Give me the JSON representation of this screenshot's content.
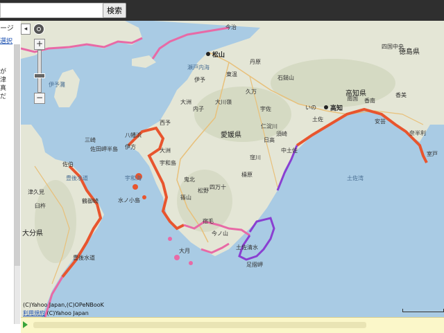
{
  "search": {
    "value": "",
    "button_label": "検索"
  },
  "sidebar": {
    "top_label": "ージ",
    "link_label": "選択",
    "snippets": [
      "が",
      "津",
      "真",
      "だ"
    ]
  },
  "controls": {
    "collapse_label": "◂",
    "zoom_in_label": "+",
    "zoom_out_label": "−"
  },
  "map": {
    "prefectures": [
      "愛媛県",
      "高知県",
      "徳島県",
      "大分県"
    ],
    "cities": [
      "松山",
      "高知",
      "宇和島",
      "大洲",
      "八幡浜",
      "西予",
      "宿毛",
      "土佐清水",
      "大月",
      "四万十",
      "須崎",
      "安芸",
      "今治",
      "佐伯",
      "臼杵",
      "津久見"
    ],
    "places": [
      "大川嶺",
      "石鎚山",
      "東温",
      "久万",
      "伊予",
      "内子",
      "仁淀川",
      "いの",
      "土佐",
      "南国",
      "香南",
      "香美",
      "奈半利",
      "室戸",
      "日高",
      "中土佐",
      "檮原",
      "鬼北",
      "松野",
      "四国中央",
      "丹原",
      "三崎",
      "伊方",
      "佐田岬半島",
      "宇佐",
      "窪川",
      "今ノ山",
      "篠山",
      "足摺岬",
      "水ノ小島",
      "鶴御崎",
      "豊後水道",
      "大洲"
    ],
    "seas": [
      "瀬戸内海",
      "宇和海",
      "豊後水道",
      "伊予灘",
      "土佐湾"
    ],
    "hazard_colors": {
      "high": "#e8552e",
      "mid": "#e86aa6",
      "low": "#8a3fd1"
    }
  },
  "footer": {
    "copyright": "(C)Yahoo Japan,(C)OPeNBooK",
    "attribution_link": "利用規約",
    "attribution_rest": " (C)Yahoo Japan"
  }
}
